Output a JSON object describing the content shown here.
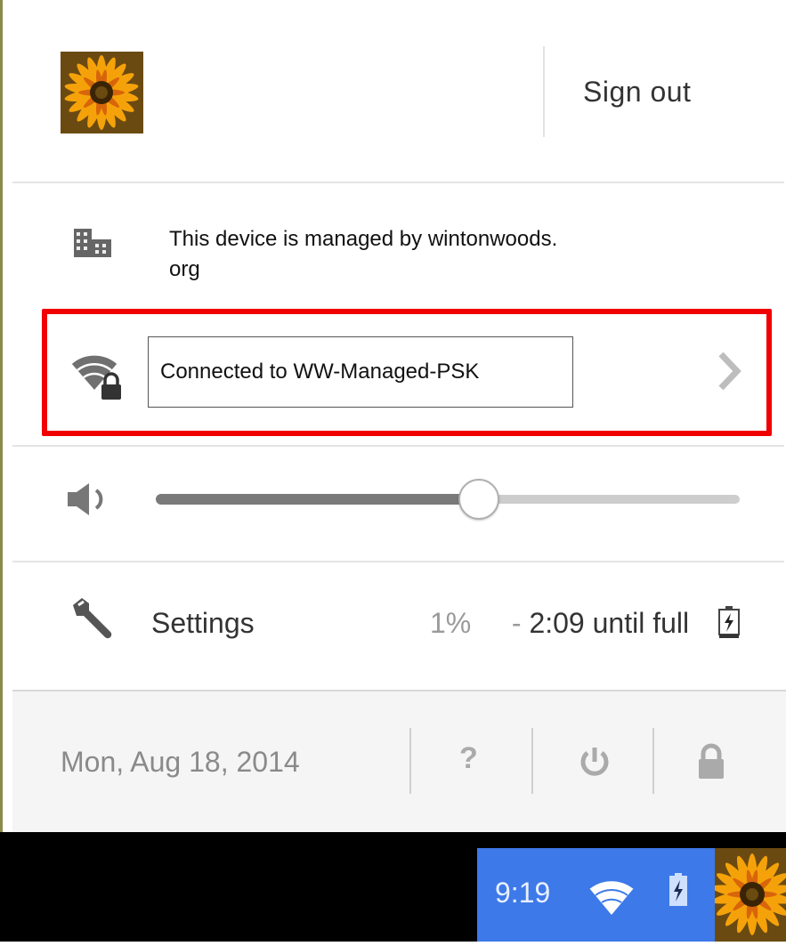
{
  "user": {
    "sign_out_label": "Sign out",
    "avatar_icon": "flower-avatar"
  },
  "managed": {
    "text": "This device is managed by wintonwoods.\norg",
    "icon": "building-icon"
  },
  "network": {
    "status": "Connected to WW-Managed-PSK",
    "icon": "wifi-lock-icon",
    "chevron_icon": "chevron-right-icon",
    "highlight_color": "#f00000"
  },
  "volume": {
    "level_percent": 55,
    "icon": "speaker-icon"
  },
  "settings": {
    "label": "Settings",
    "battery_percent": "1%",
    "battery_separator": " - ",
    "battery_time": "2:09 until full",
    "battery_icon": "battery-charging-icon"
  },
  "footer": {
    "date": "Mon, Aug 18, 2014",
    "help_label": "?",
    "power_icon": "power-icon",
    "lock_icon": "lock-icon"
  },
  "shelf": {
    "time": "9:19",
    "tray_color": "#3d79e8"
  }
}
